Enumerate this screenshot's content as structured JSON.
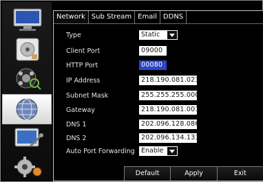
{
  "tabs": [
    "Network",
    "Sub Stream",
    "Email",
    "DDNS"
  ],
  "active_tab": "Network",
  "sidebar": {
    "items": [
      {
        "name": "monitor-icon"
      },
      {
        "name": "disk-icon"
      },
      {
        "name": "camera-search-icon"
      },
      {
        "name": "network-globe-icon"
      },
      {
        "name": "system-tools-icon"
      },
      {
        "name": "settings-gear-icon"
      }
    ],
    "active_index": 3
  },
  "form": {
    "type_label": "Type",
    "type_value": "Static",
    "client_port_label": "Client Port",
    "client_port_value": "09000",
    "http_port_label": "HTTP Port",
    "http_port_value": "00080",
    "ip_label": "IP Address",
    "ip_value": "218.190.081.023",
    "subnet_label": "Subnet Mask",
    "subnet_value": "255.255.255.000",
    "gateway_label": "Gateway",
    "gateway_value": "218.190.081.001",
    "dns1_label": "DNS 1",
    "dns1_value": "202.096.128.086",
    "dns2_label": "DNS 2",
    "dns2_value": "202.096.134.133",
    "apf_label": "Auto Port Forwarding",
    "apf_value": "Enable"
  },
  "buttons": {
    "default": "Default",
    "apply": "Apply",
    "exit": "Exit"
  },
  "colors": {
    "selection": "#2b46c7",
    "background": "#000000",
    "field": "#ffffff"
  }
}
